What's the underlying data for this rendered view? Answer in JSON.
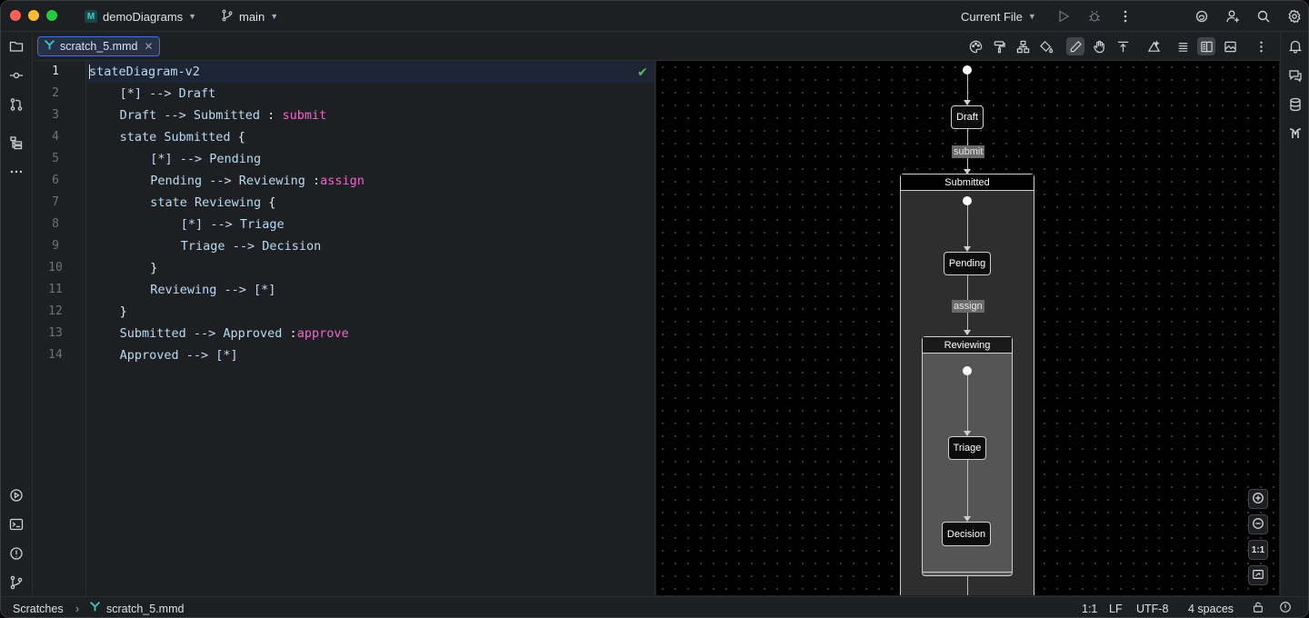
{
  "titlebar": {
    "project": "demoDiagrams",
    "branch": "main",
    "run_config": "Current File"
  },
  "tab": {
    "filename": "scratch_5.mmd"
  },
  "editor": {
    "line_numbers": [
      "1",
      "2",
      "3",
      "4",
      "5",
      "6",
      "7",
      "8",
      "9",
      "10",
      "11",
      "12",
      "13",
      "14"
    ],
    "lines": [
      {
        "indent": 0,
        "parts": [
          {
            "t": "stateDiagram-v2",
            "c": "kw"
          }
        ]
      },
      {
        "indent": 1,
        "parts": [
          {
            "t": "[*] ",
            "c": "sym"
          },
          {
            "t": "--> ",
            "c": "sym"
          },
          {
            "t": "Draft",
            "c": "kw"
          }
        ]
      },
      {
        "indent": 1,
        "parts": [
          {
            "t": "Draft ",
            "c": "kw"
          },
          {
            "t": "--> ",
            "c": "sym"
          },
          {
            "t": "Submitted ",
            "c": "kw"
          },
          {
            "t": ": ",
            "c": "br"
          },
          {
            "t": "submit",
            "c": "lbl"
          }
        ]
      },
      {
        "indent": 1,
        "parts": [
          {
            "t": "state ",
            "c": "kw"
          },
          {
            "t": "Submitted ",
            "c": "kw"
          },
          {
            "t": "{",
            "c": "br"
          }
        ]
      },
      {
        "indent": 2,
        "parts": [
          {
            "t": "[*] ",
            "c": "sym"
          },
          {
            "t": "--> ",
            "c": "sym"
          },
          {
            "t": "Pending",
            "c": "kw"
          }
        ]
      },
      {
        "indent": 2,
        "parts": [
          {
            "t": "Pending ",
            "c": "kw"
          },
          {
            "t": "--> ",
            "c": "sym"
          },
          {
            "t": "Reviewing ",
            "c": "kw"
          },
          {
            "t": ":",
            "c": "br"
          },
          {
            "t": "assign",
            "c": "lbl"
          }
        ]
      },
      {
        "indent": 2,
        "parts": [
          {
            "t": "state ",
            "c": "kw"
          },
          {
            "t": "Reviewing ",
            "c": "kw"
          },
          {
            "t": "{",
            "c": "br"
          }
        ]
      },
      {
        "indent": 3,
        "parts": [
          {
            "t": "[*] ",
            "c": "sym"
          },
          {
            "t": "--> ",
            "c": "sym"
          },
          {
            "t": "Triage",
            "c": "kw"
          }
        ]
      },
      {
        "indent": 3,
        "parts": [
          {
            "t": "Triage ",
            "c": "kw"
          },
          {
            "t": "--> ",
            "c": "sym"
          },
          {
            "t": "Decision",
            "c": "kw"
          }
        ]
      },
      {
        "indent": 2,
        "parts": [
          {
            "t": "}",
            "c": "br"
          }
        ]
      },
      {
        "indent": 2,
        "parts": [
          {
            "t": "Reviewing ",
            "c": "kw"
          },
          {
            "t": "--> ",
            "c": "sym"
          },
          {
            "t": "[*]",
            "c": "sym"
          }
        ]
      },
      {
        "indent": 1,
        "parts": [
          {
            "t": "}",
            "c": "br"
          }
        ]
      },
      {
        "indent": 1,
        "parts": [
          {
            "t": "Submitted ",
            "c": "kw"
          },
          {
            "t": "--> ",
            "c": "sym"
          },
          {
            "t": "Approved ",
            "c": "kw"
          },
          {
            "t": ":",
            "c": "br"
          },
          {
            "t": "approve",
            "c": "lbl"
          }
        ]
      },
      {
        "indent": 1,
        "parts": [
          {
            "t": "Approved ",
            "c": "kw"
          },
          {
            "t": "--> ",
            "c": "sym"
          },
          {
            "t": "[*]",
            "c": "sym"
          }
        ]
      }
    ]
  },
  "diagram": {
    "draft": "Draft",
    "submit_label": "submit",
    "submitted": "Submitted",
    "pending": "Pending",
    "assign_label": "assign",
    "reviewing": "Reviewing",
    "triage": "Triage",
    "decision": "Decision"
  },
  "zoom": {
    "actual_size": "1:1"
  },
  "statusbar": {
    "crumb_root": "Scratches",
    "crumb_file": "scratch_5.mmd",
    "position": "1:1",
    "line_sep": "LF",
    "encoding": "UTF-8",
    "indent": "4 spaces"
  },
  "colors": {
    "accent": "#3574f0",
    "keyword": "#b8dbf3",
    "label": "#ea6ac9",
    "check": "#5fb865"
  }
}
